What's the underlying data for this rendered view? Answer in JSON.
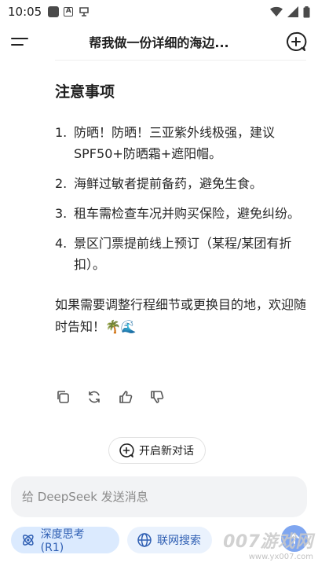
{
  "status_bar": {
    "time": "10:05",
    "icons": [
      "square-icon",
      "a-icon",
      "voice-icon",
      "wifi-icon",
      "signal-icon",
      "battery-icon"
    ]
  },
  "header": {
    "title": "帮我做一份详细的海边..."
  },
  "message": {
    "section_heading": "注意事项",
    "items": [
      {
        "num": "1.",
        "text": "防晒！防晒！三亚紫外线极强，建议SPF50+防晒霜+遮阳帽。"
      },
      {
        "num": "2.",
        "text": "海鲜过敏者提前备药，避免生食。"
      },
      {
        "num": "3.",
        "text": "租车需检查车况并购买保险，避免纠纷。"
      },
      {
        "num": "4.",
        "text": "景区门票提前线上预订（某程/某团有折扣）。"
      }
    ],
    "closing": "如果需要调整行程细节或更换目的地，欢迎随时告知！🌴🌊"
  },
  "actions": [
    "copy-icon",
    "regenerate-icon",
    "thumbs-up-icon",
    "thumbs-down-icon"
  ],
  "new_chat_label": "开启新对话",
  "input": {
    "placeholder": "给 DeepSeek 发送消息"
  },
  "chips": {
    "deepthink": "深度思考 (R1)",
    "search": "联网搜索"
  },
  "watermark": {
    "main": "007游戏网",
    "sub": "www.yx007.com"
  },
  "colors": {
    "accent": "#2f5fb3",
    "chip_bg": "#dbeafe",
    "send_bg": "#7fa6f0",
    "input_bg": "#f2f3f5"
  }
}
